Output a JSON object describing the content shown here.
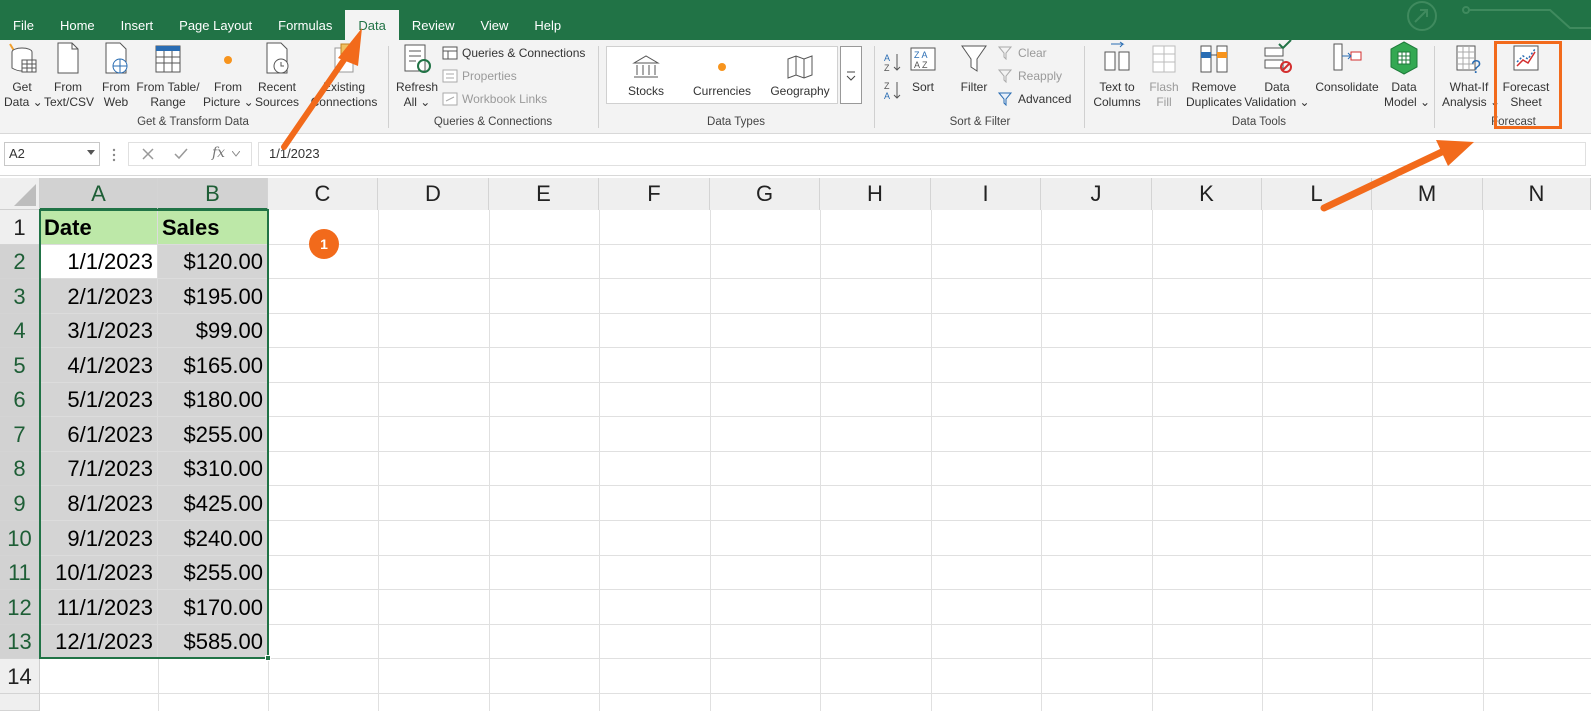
{
  "menu": {
    "tabs": [
      "File",
      "Home",
      "Insert",
      "Page Layout",
      "Formulas",
      "Data",
      "Review",
      "View",
      "Help"
    ],
    "active": "Data"
  },
  "ribbon": {
    "get_data": [
      "Get",
      "Data ⌄"
    ],
    "from_text": [
      "From",
      "Text/CSV"
    ],
    "from_web": [
      "From",
      "Web"
    ],
    "from_table": [
      "From Table/",
      "Range"
    ],
    "from_picture": [
      "From",
      "Picture ⌄"
    ],
    "recent_sources": [
      "Recent",
      "Sources"
    ],
    "existing_connections": [
      "Existing",
      "Connections"
    ],
    "group_get_transform": "Get & Transform Data",
    "refresh_all": [
      "Refresh",
      "All ⌄"
    ],
    "queries_connections": "Queries & Connections",
    "properties": "Properties",
    "workbook_links": "Workbook Links",
    "group_queries": "Queries & Connections",
    "stocks": "Stocks",
    "currencies": "Currencies",
    "geography": "Geography",
    "group_data_types": "Data Types",
    "sort": "Sort",
    "filter": "Filter",
    "clear": "Clear",
    "reapply": "Reapply",
    "advanced": "Advanced",
    "group_sort_filter": "Sort & Filter",
    "text_to_columns": [
      "Text to",
      "Columns"
    ],
    "flash_fill": [
      "Flash",
      "Fill"
    ],
    "remove_duplicates": [
      "Remove",
      "Duplicates"
    ],
    "data_validation": [
      "Data",
      "Validation ⌄"
    ],
    "consolidate": "Consolidate",
    "data_model": [
      "Data",
      "Model ⌄"
    ],
    "group_data_tools": "Data Tools",
    "what_if": [
      "What-If",
      "Analysis ⌄"
    ],
    "forecast_sheet": [
      "Forecast",
      "Sheet"
    ],
    "group_forecast": "Forecast"
  },
  "formula_bar": {
    "name_box": "A2",
    "fx": "fx",
    "value": "1/1/2023"
  },
  "columns": [
    "A",
    "B",
    "C",
    "D",
    "E",
    "F",
    "G",
    "H",
    "I",
    "J",
    "K",
    "L",
    "M",
    "N"
  ],
  "rows": [
    "1",
    "2",
    "3",
    "4",
    "5",
    "6",
    "7",
    "8",
    "9",
    "10",
    "11",
    "12",
    "13",
    "14"
  ],
  "table": {
    "headers": [
      "Date",
      "Sales"
    ],
    "data": [
      [
        "1/1/2023",
        "$120.00"
      ],
      [
        "2/1/2023",
        "$195.00"
      ],
      [
        "3/1/2023",
        "$99.00"
      ],
      [
        "4/1/2023",
        "$165.00"
      ],
      [
        "5/1/2023",
        "$180.00"
      ],
      [
        "6/1/2023",
        "$255.00"
      ],
      [
        "7/1/2023",
        "$310.00"
      ],
      [
        "8/1/2023",
        "$425.00"
      ],
      [
        "9/1/2023",
        "$240.00"
      ],
      [
        "10/1/2023",
        "$255.00"
      ],
      [
        "11/1/2023",
        "$170.00"
      ],
      [
        "12/1/2023",
        "$585.00"
      ]
    ]
  },
  "callout": {
    "step": "1"
  },
  "colors": {
    "accent": "#217346",
    "highlight": "#F26A1B",
    "header_fill": "#BDE8A8",
    "selection": "#D4D4D4"
  }
}
